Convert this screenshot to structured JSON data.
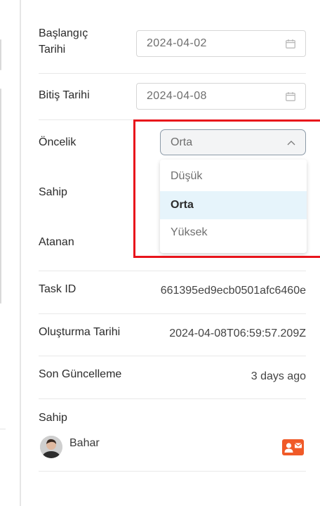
{
  "fields": {
    "start_date": {
      "label_line1": "Başlangıç",
      "label_line2": "Tarihi",
      "value": "2024-04-02"
    },
    "end_date": {
      "label": "Bitiş Tarihi",
      "value": "2024-04-08"
    },
    "priority": {
      "label": "Öncelik",
      "selected": "Orta",
      "options": [
        "Düşük",
        "Orta",
        "Yüksek"
      ]
    },
    "owner_label": "Sahip",
    "assignee_label": "Atanan"
  },
  "meta": {
    "task_id_label": "Task ID",
    "task_id_value": "661395ed9ecb0501afc6460e",
    "created_label": "Oluşturma Tarihi",
    "created_value": "2024-04-08T06:59:57.209Z",
    "updated_label": "Son Güncelleme",
    "updated_value": "3 days ago"
  },
  "owner_section": {
    "title": "Sahip",
    "name": "Bahar"
  },
  "colors": {
    "highlight": "#e8141b",
    "selected_option_bg": "#e6f4fb",
    "contact_icon": "#f05a28"
  },
  "icons": {
    "date": "calendar-icon",
    "select": "chevron-up-icon",
    "contact": "contact-card-icon"
  }
}
